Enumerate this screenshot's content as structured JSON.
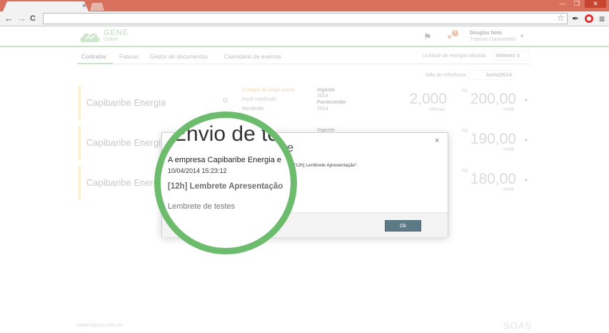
{
  "browser": {
    "tab_close": "×",
    "window_buttons": [
      "—",
      "❐",
      "✕"
    ],
    "nav": {
      "back": "←",
      "forward": "→",
      "reload": "C"
    },
    "star": "☆",
    "dropper": "✒",
    "menu": "≡"
  },
  "app": {
    "logo_main": "GENE",
    "logo_sub": "Online",
    "notification_count": "5",
    "user_name": "Douglas Neto",
    "user_role": "Trayoso Consumidor",
    "user_caret": "▾",
    "tabs": [
      "Contratos",
      "Faturas",
      "Gestor de documentos",
      "Calendário de eventos"
    ],
    "unit_label": "Unidade de energia utilizada",
    "unit_value": "MWmed  ⇕",
    "ref_label": "Mês de referência",
    "ref_value": "Junho/2014",
    "contracts": [
      {
        "name": "Capibaribe Energia",
        "meta1": "Compra de longo prazo",
        "meta2": "Perfil indefinido",
        "meta3": "Nordeste",
        "meta4": "Vigente",
        "meta5": "2014",
        "meta6": "Fornecendo",
        "meta7": "2014",
        "volume": "2,000",
        "volume_unit": "MWmed",
        "rs": "R$",
        "price": "200,00",
        "price_unit": "/ MWh",
        "caret": "▾"
      },
      {
        "name": "Capibaribe Energia",
        "meta1": "",
        "meta2": "",
        "meta3": "",
        "meta4": "Vigente",
        "meta5": "",
        "meta6": "",
        "meta7": "",
        "volume": "",
        "volume_unit": "",
        "rs": "R$",
        "price": "190,00",
        "price_unit": "/ MWh",
        "caret": "▾"
      },
      {
        "name": "Capibaribe Energia",
        "meta1": "",
        "meta2": "",
        "meta3": "",
        "meta4": "",
        "meta5": "",
        "meta6": "",
        "meta7": "",
        "volume": "",
        "volume_unit": "",
        "rs": "R$",
        "price": "180,00",
        "price_unit": "/ MWh",
        "caret": "▾"
      }
    ],
    "footer": "www.trayoso.com.br",
    "footer_logo": "SOAS"
  },
  "modal": {
    "title": "te",
    "close": "×",
    "body": "ete \"[12h] Lembrete Apresentação\".",
    "ok_label": "Ok"
  },
  "magnifier": {
    "title": "Envio de tes",
    "company": "A empresa Capibaribe Energia e",
    "date": "10/04/2014 15:23:12",
    "subject": "[12h] Lembrete Apresentação",
    "description": "Lembrete de testes"
  },
  "colors": {
    "accent_green": "#6dbb6d",
    "titlebar": "#d8705e",
    "ok_button": "#5b7a85"
  }
}
